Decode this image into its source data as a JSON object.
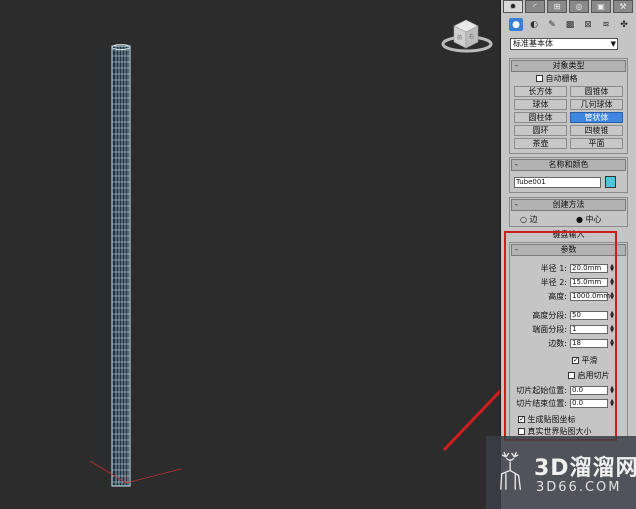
{
  "command_panel": {
    "main_tabs": [
      "create-icon",
      "modify-icon",
      "hierarchy-icon",
      "motion-icon",
      "display-icon",
      "utilities-icon"
    ],
    "category_select": "标准基本体",
    "object_type": {
      "title": "对象类型",
      "auto_grid_label": "自动栅格",
      "buttons": [
        "长方体",
        "圆锥体",
        "球体",
        "几何球体",
        "圆柱体",
        "管状体",
        "圆环",
        "四棱锥",
        "茶壶",
        "平面"
      ],
      "active_button": "管状体"
    },
    "name_color": {
      "title": "名称和颜色",
      "name_value": "Tube001",
      "color": "#4fc3d9"
    },
    "creation_method": {
      "title": "创建方法",
      "option_edge": "边",
      "option_center": "中心",
      "selected": "中心"
    },
    "keyboard_input_title": "键盘输入",
    "parameters": {
      "title": "参数",
      "radius1_label": "半径 1:",
      "radius1_value": "20.0mm",
      "radius2_label": "半径 2:",
      "radius2_value": "15.0mm",
      "height_label": "高度:",
      "height_value": "1000.0mm",
      "height_segments_label": "高度分段:",
      "height_segments_value": "50",
      "cap_segments_label": "端面分段:",
      "cap_segments_value": "1",
      "sides_label": "边数:",
      "sides_value": "18",
      "smooth_label": "平滑",
      "enable_slice_label": "启用切片",
      "slice_from_label": "切片起始位置:",
      "slice_from_value": "0.0",
      "slice_to_label": "切片结束位置:",
      "slice_to_value": "0.0",
      "gen_mapping_label": "生成贴图坐标",
      "real_world_label": "真实世界贴图大小"
    }
  },
  "watermark": {
    "brand": "3D溜溜网",
    "url": "3D66.COM"
  },
  "colors": {
    "highlight": "#d01c1c",
    "accent": "#3f86e0",
    "tube_wire": "#cfe8f2"
  }
}
